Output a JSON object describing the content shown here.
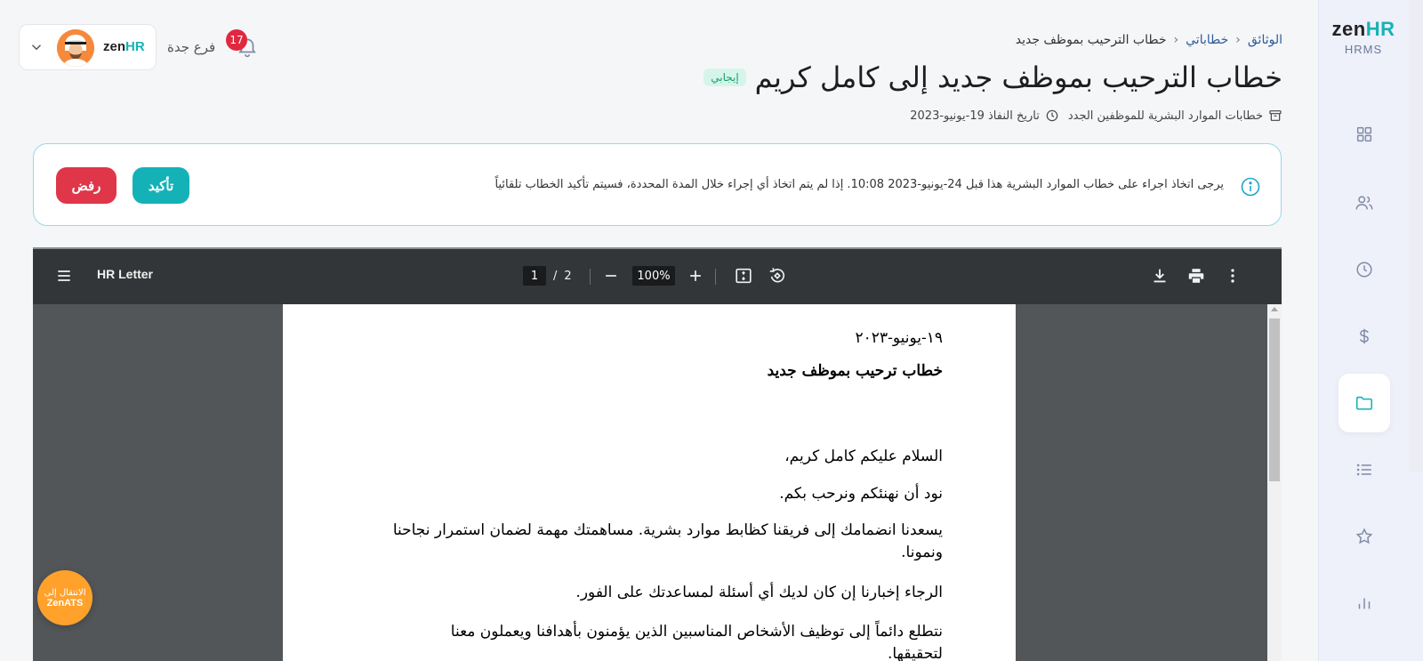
{
  "sidebar": {
    "logo_main": "zen",
    "logo_accent": "HR",
    "logo_sub": "HRMS",
    "items": [
      {
        "icon": "dashboard-grid-icon"
      },
      {
        "icon": "users-icon"
      },
      {
        "icon": "clock-icon"
      },
      {
        "icon": "dollar-icon"
      },
      {
        "icon": "folder-icon",
        "active": true
      },
      {
        "icon": "list-icon"
      },
      {
        "icon": "star-icon"
      },
      {
        "icon": "bar-chart-icon"
      }
    ]
  },
  "header": {
    "user_chip_logo_main": "zen",
    "user_chip_logo_accent": "HR",
    "branch": "فرع جدة",
    "notifications_count": "17"
  },
  "breadcrumb": {
    "items": [
      "الوثائق",
      "خطاباتي",
      "خطاب الترحيب بموظف جديد"
    ]
  },
  "page": {
    "title": "خطاب الترحيب بموظف جديد إلى كامل كريم",
    "status": "إيجابي",
    "category": "خطابات الموارد البشرية للموظفين الجدد",
    "effective_date": "تاريخ النفاذ 19-يونيو-2023"
  },
  "alert": {
    "text": "يرجى اتخاذ اجراء على خطاب الموارد البشرية هذا قبل 24-يونيو-2023 10:08. إذا لم يتم اتخاذ أي إجراء خلال المدة المحددة، فسيتم تأكيد الخطاب تلقائياً",
    "confirm_label": "تأكيد",
    "reject_label": "رفض"
  },
  "viewer": {
    "title": "HR Letter",
    "current_page": "1",
    "page_separator": "/",
    "total_pages": "2",
    "zoom": "100%"
  },
  "document": {
    "date": "١٩-يونيو-٢٠٢٣",
    "heading": "خطاب ترحيب بموظف جديد",
    "greeting": "السلام عليكم كامل كريم،",
    "p1": "نود أن نهنئكم ونرحب بكم.",
    "p2": "يسعدنا انضمامك إلى فريقنا كظابط موارد بشرية. مساهمتك مهمة لضمان استمرار نجاحنا ونمونا.",
    "p3": "الرجاء إخبارنا إن كان لديك أي أسئلة لمساعدتك على الفور.",
    "p4": "نتطلع دائماً إلى توظيف الأشخاص المناسبين الذين يؤمنون بأهدافنا ويعملون معنا لتحقيقها."
  },
  "fab": {
    "line1": "الانتقال إلى",
    "line2": "ZenATS"
  },
  "colors": {
    "accent": "#14b2b6",
    "danger": "#df3649",
    "fab": "#ffa12b",
    "badge": "#e0283f"
  }
}
